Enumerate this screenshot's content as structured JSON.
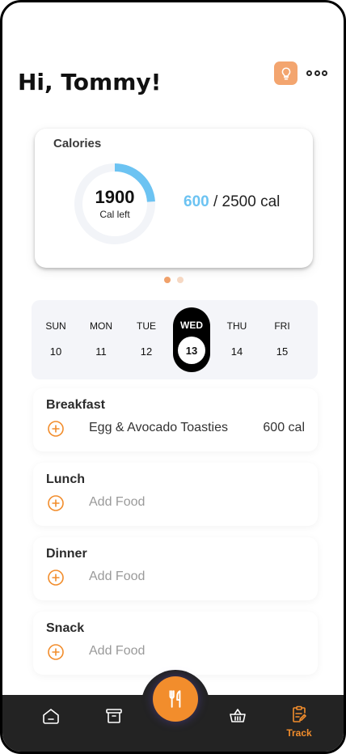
{
  "header": {
    "greeting": "Hi, Tommy!",
    "tip_icon": "lightbulb-icon",
    "more_icon": "more-horizontal-icon"
  },
  "calories": {
    "title": "Calories",
    "remaining": "1900",
    "remaining_label": "Cal left",
    "consumed": "600",
    "separator": "/",
    "goal": "2500 cal",
    "progress_fraction": 0.24,
    "accent": "#6cc3f2",
    "ring_track": "#f2f4f8"
  },
  "carousel": {
    "pages": 2,
    "active": 0
  },
  "week": {
    "days": [
      {
        "name": "SUN",
        "num": "10"
      },
      {
        "name": "MON",
        "num": "11"
      },
      {
        "name": "TUE",
        "num": "12"
      },
      {
        "name": "WED",
        "num": "13"
      },
      {
        "name": "THU",
        "num": "14"
      },
      {
        "name": "FRI",
        "num": "15"
      }
    ],
    "selected_index": 3
  },
  "meals": [
    {
      "title": "Breakfast",
      "food": "Egg & Avocado Toasties",
      "cal": "600 cal"
    },
    {
      "title": "Lunch",
      "food": "Add Food",
      "cal": ""
    },
    {
      "title": "Dinner",
      "food": "Add Food",
      "cal": ""
    },
    {
      "title": "Snack",
      "food": "Add Food",
      "cal": ""
    }
  ],
  "tabbar": {
    "items": [
      {
        "icon": "home-icon"
      },
      {
        "icon": "archive-icon"
      },
      {
        "icon": "basket-icon"
      },
      {
        "icon": "clipboard-edit-icon",
        "label": "Track"
      }
    ],
    "fab_icon": "fork-knife-icon",
    "accent": "#f28d2c"
  }
}
